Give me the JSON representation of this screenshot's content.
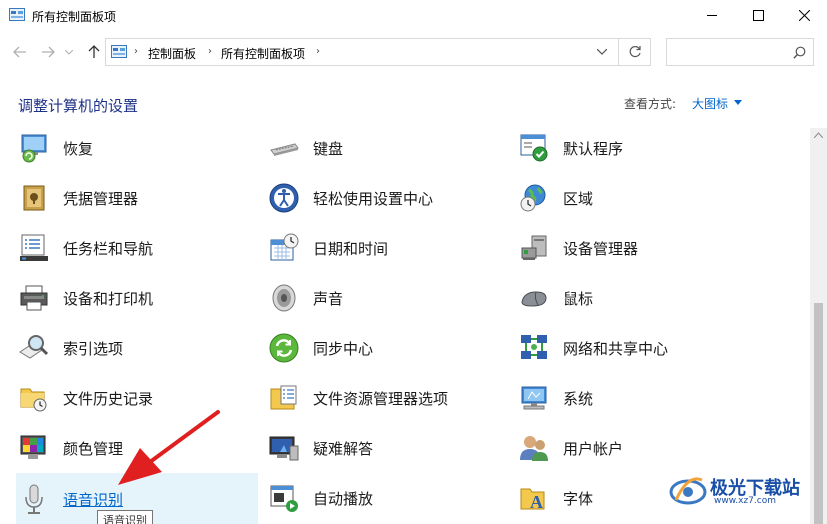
{
  "window": {
    "title": "所有控制面板项",
    "controls": {
      "minimize": "minimize-icon",
      "maximize": "maximize-icon",
      "close": "close-icon"
    }
  },
  "nav": {
    "breadcrumb": [
      "控制面板",
      "所有控制面板项"
    ],
    "search_placeholder": ""
  },
  "header": {
    "title": "调整计算机的设置",
    "view_by_label": "查看方式:",
    "view_by_value": "大图标"
  },
  "items": [
    {
      "label": "恢复",
      "icon": "recovery-icon"
    },
    {
      "label": "键盘",
      "icon": "keyboard-icon"
    },
    {
      "label": "默认程序",
      "icon": "default-programs-icon"
    },
    {
      "label": "凭据管理器",
      "icon": "credential-manager-icon"
    },
    {
      "label": "轻松使用设置中心",
      "icon": "ease-of-access-icon"
    },
    {
      "label": "区域",
      "icon": "region-icon"
    },
    {
      "label": "任务栏和导航",
      "icon": "taskbar-icon"
    },
    {
      "label": "日期和时间",
      "icon": "date-time-icon"
    },
    {
      "label": "设备管理器",
      "icon": "device-manager-icon"
    },
    {
      "label": "设备和打印机",
      "icon": "devices-printers-icon"
    },
    {
      "label": "声音",
      "icon": "sound-icon"
    },
    {
      "label": "鼠标",
      "icon": "mouse-icon"
    },
    {
      "label": "索引选项",
      "icon": "indexing-options-icon"
    },
    {
      "label": "同步中心",
      "icon": "sync-center-icon"
    },
    {
      "label": "网络和共享中心",
      "icon": "network-sharing-icon"
    },
    {
      "label": "文件历史记录",
      "icon": "file-history-icon"
    },
    {
      "label": "文件资源管理器选项",
      "icon": "file-explorer-options-icon"
    },
    {
      "label": "系统",
      "icon": "system-icon"
    },
    {
      "label": "颜色管理",
      "icon": "color-management-icon"
    },
    {
      "label": "疑难解答",
      "icon": "troubleshooting-icon"
    },
    {
      "label": "用户帐户",
      "icon": "user-accounts-icon"
    },
    {
      "label": "语音识别",
      "icon": "speech-recognition-icon",
      "hovered": true
    },
    {
      "label": "自动播放",
      "icon": "autoplay-icon"
    },
    {
      "label": "字体",
      "icon": "fonts-icon"
    }
  ],
  "tooltip": "语音识别",
  "watermark": {
    "text": "极光下载站",
    "url": "www.xz7.com"
  },
  "colors": {
    "title_blue": "#1e3287",
    "link_blue": "#0066cc",
    "hover_bg": "#e5f3fb",
    "arrow_red": "#e02020"
  }
}
